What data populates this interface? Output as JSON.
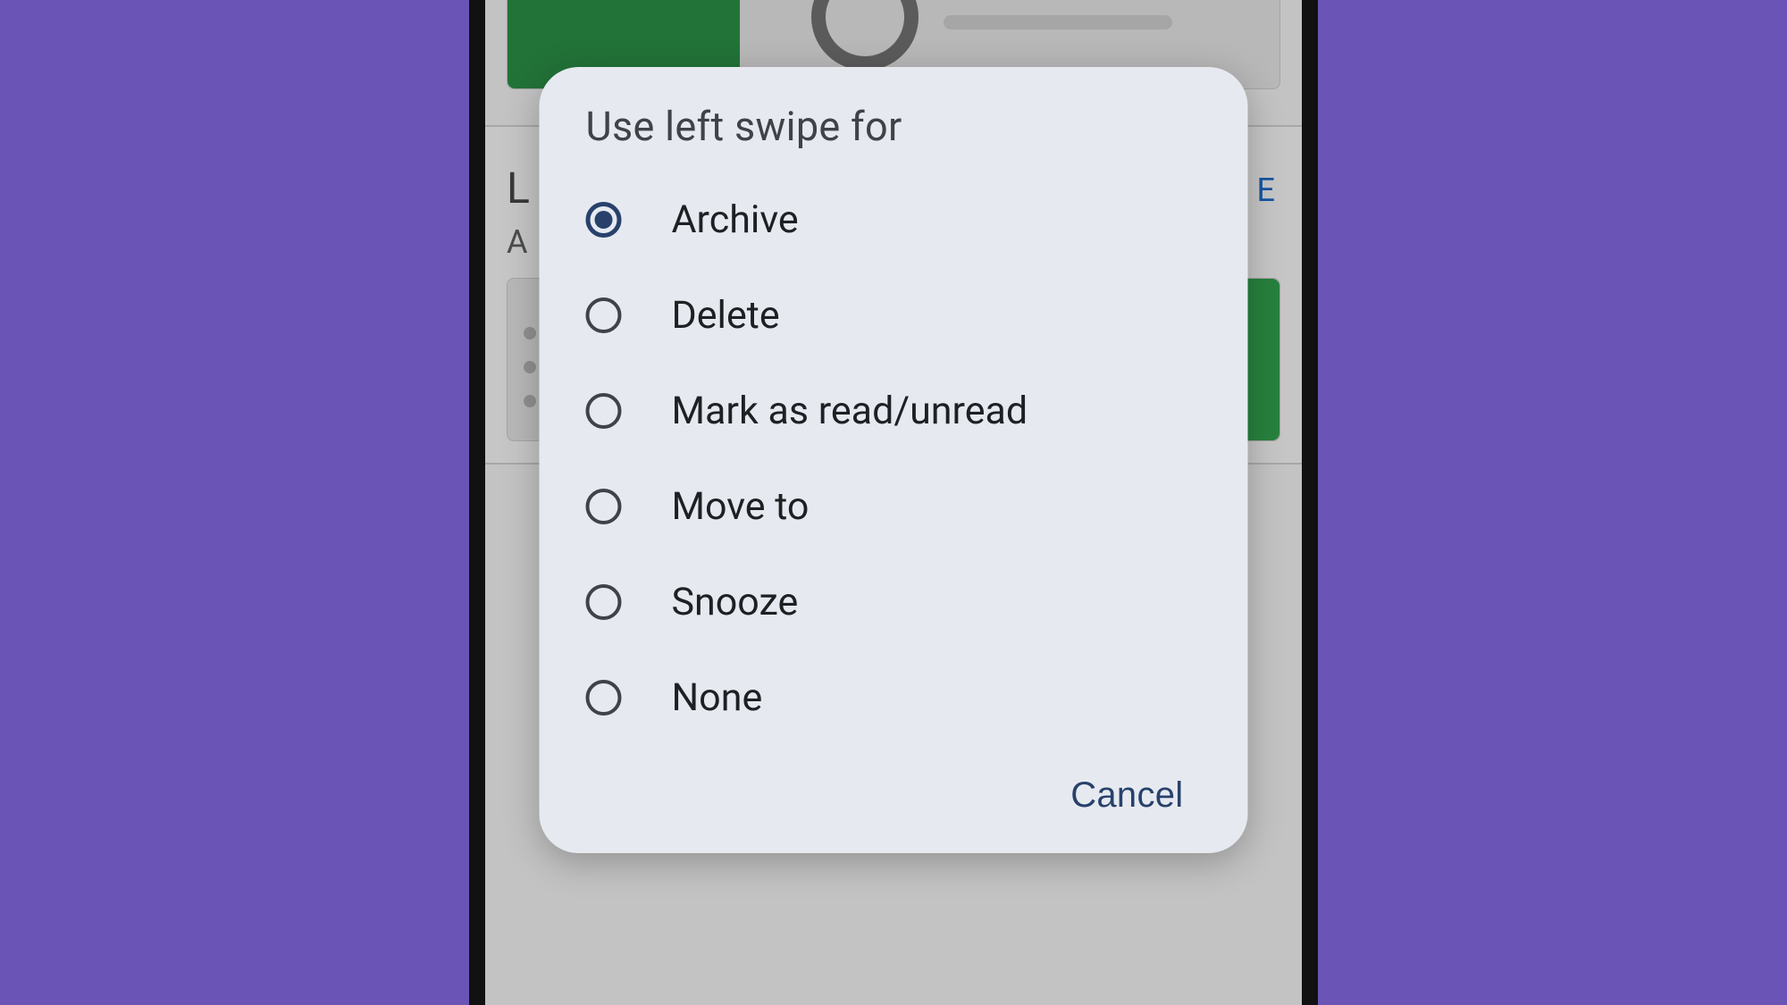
{
  "dialog": {
    "title": "Use left swipe for",
    "options": [
      {
        "label": "Archive",
        "selected": true
      },
      {
        "label": "Delete",
        "selected": false
      },
      {
        "label": "Mark as read/unread",
        "selected": false
      },
      {
        "label": "Move to",
        "selected": false
      },
      {
        "label": "Snooze",
        "selected": false
      },
      {
        "label": "None",
        "selected": false
      }
    ],
    "cancel_label": "Cancel"
  },
  "background": {
    "section_title_partial": "L",
    "section_sub_partial": "A",
    "link_partial": "E",
    "colors": {
      "accent_green": "#2f9c4b",
      "primary_text": "#1e2124",
      "dialog_bg": "#e6eaf0",
      "radio_selected": "#28416b",
      "page_bg": "#6a55b6"
    }
  }
}
